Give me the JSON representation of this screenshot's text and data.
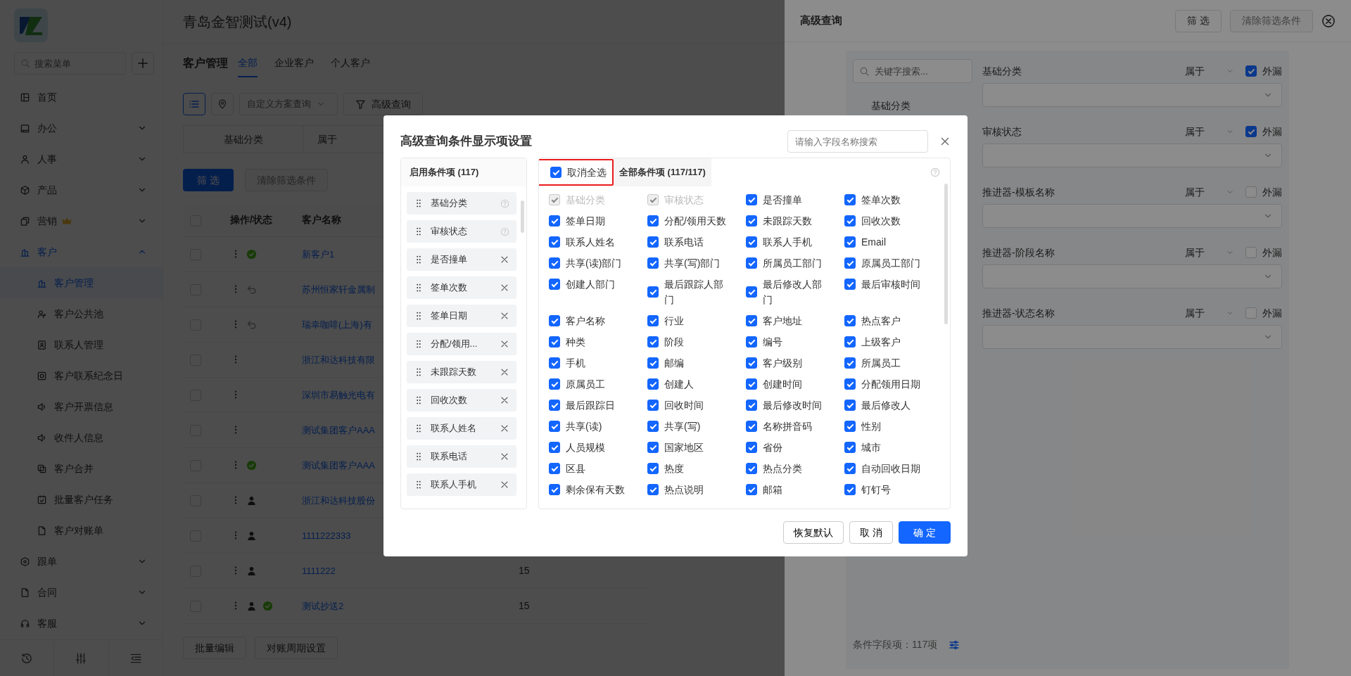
{
  "app": {
    "title": "青岛金智测试(v4)"
  },
  "sidebar": {
    "search": {
      "placeholder": "搜索菜单"
    },
    "items": [
      {
        "label": "首页",
        "kind": "link",
        "selected": false,
        "premium": false
      },
      {
        "label": "办公",
        "kind": "group",
        "expanded": false,
        "selected": false,
        "premium": false
      },
      {
        "label": "人事",
        "kind": "group",
        "expanded": false,
        "selected": false,
        "premium": false
      },
      {
        "label": "产品",
        "kind": "group",
        "expanded": false,
        "selected": false,
        "premium": false
      },
      {
        "label": "营销",
        "kind": "group",
        "expanded": false,
        "selected": false,
        "premium": true
      },
      {
        "label": "客户",
        "kind": "group",
        "expanded": true,
        "selected": true,
        "premium": false,
        "children": [
          {
            "label": "客户管理",
            "selected": true
          },
          {
            "label": "客户公共池",
            "selected": false
          },
          {
            "label": "联系人管理",
            "selected": false
          },
          {
            "label": "客户联系纪念日",
            "selected": false
          },
          {
            "label": "客户开票信息",
            "selected": false
          },
          {
            "label": "收件人信息",
            "selected": false
          },
          {
            "label": "客户合并",
            "selected": false
          },
          {
            "label": "批量客户任务",
            "selected": false
          },
          {
            "label": "客户对账单",
            "selected": false
          }
        ]
      },
      {
        "label": "跟单",
        "kind": "group",
        "expanded": false,
        "selected": false,
        "premium": false
      },
      {
        "label": "合同",
        "kind": "group",
        "expanded": false,
        "selected": false,
        "premium": false
      },
      {
        "label": "客服",
        "kind": "group",
        "expanded": false,
        "selected": false,
        "premium": false
      }
    ]
  },
  "main": {
    "title": "客户管理",
    "tabs": [
      {
        "label": "全部",
        "selected": true
      },
      {
        "label": "企业客户",
        "selected": false
      },
      {
        "label": "个人客户",
        "selected": false
      }
    ],
    "view_modes": [
      {
        "kind": "list",
        "selected": true
      },
      {
        "kind": "map",
        "selected": false
      }
    ],
    "scheme_select": {
      "placeholder": "自定义方案查询"
    },
    "advanced_button": "高级查询",
    "filter": {
      "field": "基础分类",
      "operator": "属于"
    },
    "filter_button": "筛 选",
    "clear_button": {
      "label": "清除筛选条件",
      "disabled": true
    },
    "table": {
      "select_all": false,
      "columns": [
        "操作/状态",
        "客户名称"
      ],
      "rows": [
        {
          "selected": false,
          "status": [
            {
              "kind": "approved"
            }
          ],
          "name": "新客户1"
        },
        {
          "selected": false,
          "status": [
            {
              "kind": "returned"
            }
          ],
          "name": "苏州恒家轩金属制"
        },
        {
          "selected": false,
          "status": [
            {
              "kind": "returned"
            }
          ],
          "name": "瑞幸咖啡(上海)有"
        },
        {
          "selected": false,
          "status": [],
          "name": "浙江和达科技有限"
        },
        {
          "selected": false,
          "status": [],
          "name": "深圳市易触光电有"
        },
        {
          "selected": false,
          "status": [],
          "name": "测试集团客户AAA"
        },
        {
          "selected": false,
          "status": [
            {
              "kind": "approved"
            }
          ],
          "name": "测试集团客户AAA"
        },
        {
          "selected": false,
          "status": [
            {
              "kind": "personal"
            }
          ],
          "name": "浙江和达科技股份"
        },
        {
          "selected": false,
          "status": [
            {
              "kind": "personal"
            }
          ],
          "name": "1111222333"
        },
        {
          "selected": false,
          "status": [
            {
              "kind": "personal"
            }
          ],
          "name": "1111222",
          "column_4": "15"
        },
        {
          "selected": false,
          "status": [
            {
              "kind": "personal"
            },
            {
              "kind": "approved"
            }
          ],
          "name": "测试抄送2",
          "column_4": "15"
        }
      ]
    },
    "footer_buttons": [
      "批量编辑",
      "对账周期设置"
    ]
  },
  "drawer": {
    "title": "高级查询",
    "filter_button": "筛 选",
    "clear_button": {
      "label": "清除筛选条件",
      "disabled": true
    },
    "search": {
      "placeholder": "关键字搜索..."
    },
    "field_list": [
      "基础分类"
    ],
    "conditions": [
      {
        "label": "基础分类",
        "operator": "属于",
        "outer_label": "外漏",
        "outer": true
      },
      {
        "label": "审核状态",
        "operator": "属于",
        "outer_label": "外漏",
        "outer": true
      },
      {
        "label": "推进器-模板名称",
        "operator": "属于",
        "outer_label": "外漏",
        "outer": false
      },
      {
        "label": "推进器-阶段名称",
        "operator": "属于",
        "outer_label": "外漏",
        "outer": false
      },
      {
        "label": "推进器-状态名称",
        "operator": "属于",
        "outer_label": "外漏",
        "outer": false
      }
    ],
    "footer": "条件字段项：117项"
  },
  "modal": {
    "title": "高级查询条件显示项设置",
    "search": {
      "placeholder": "请输入字段名称搜索"
    },
    "enabled": {
      "title": "启用条件项 (117)",
      "items": [
        {
          "label": "基础分类",
          "kind": "locked"
        },
        {
          "label": "审核状态",
          "kind": "locked"
        },
        {
          "label": "是否撞单",
          "kind": "removable"
        },
        {
          "label": "签单次数",
          "kind": "removable"
        },
        {
          "label": "签单日期",
          "kind": "removable"
        },
        {
          "label": "分配/领用...",
          "kind": "removable"
        },
        {
          "label": "未跟踪天数",
          "kind": "removable"
        },
        {
          "label": "回收次数",
          "kind": "removable"
        },
        {
          "label": "联系人姓名",
          "kind": "removable"
        },
        {
          "label": "联系电话",
          "kind": "removable"
        },
        {
          "label": "联系人手机",
          "kind": "removable"
        }
      ]
    },
    "all": {
      "toggle": {
        "label": "取消全选",
        "checked": true,
        "highlighted": true
      },
      "title": "全部条件项 (117/117)",
      "items": [
        {
          "label": "基础分类",
          "checked": true,
          "disabled": true
        },
        {
          "label": "审核状态",
          "checked": true,
          "disabled": true
        },
        {
          "label": "是否撞单",
          "checked": true,
          "disabled": false
        },
        {
          "label": "签单次数",
          "checked": true,
          "disabled": false
        },
        {
          "label": "签单日期",
          "checked": true,
          "disabled": false
        },
        {
          "label": "分配/领用天数",
          "checked": true,
          "disabled": false
        },
        {
          "label": "未跟踪天数",
          "checked": true,
          "disabled": false
        },
        {
          "label": "回收次数",
          "checked": true,
          "disabled": false
        },
        {
          "label": "联系人姓名",
          "checked": true,
          "disabled": false
        },
        {
          "label": "联系电话",
          "checked": true,
          "disabled": false
        },
        {
          "label": "联系人手机",
          "checked": true,
          "disabled": false
        },
        {
          "label": "Email",
          "checked": true,
          "disabled": false
        },
        {
          "label": "共享(读)部门",
          "checked": true,
          "disabled": false
        },
        {
          "label": "共享(写)部门",
          "checked": true,
          "disabled": false
        },
        {
          "label": "所属员工部门",
          "checked": true,
          "disabled": false
        },
        {
          "label": "原属员工部门",
          "checked": true,
          "disabled": false
        },
        {
          "label": "创建人部门",
          "checked": true,
          "disabled": false
        },
        {
          "label": "最后跟踪人部门",
          "checked": true,
          "disabled": false
        },
        {
          "label": "最后修改人部门",
          "checked": true,
          "disabled": false
        },
        {
          "label": "最后审核时间",
          "checked": true,
          "disabled": false
        },
        {
          "label": "客户名称",
          "checked": true,
          "disabled": false
        },
        {
          "label": "行业",
          "checked": true,
          "disabled": false
        },
        {
          "label": "客户地址",
          "checked": true,
          "disabled": false
        },
        {
          "label": "热点客户",
          "checked": true,
          "disabled": false
        },
        {
          "label": "种类",
          "checked": true,
          "disabled": false
        },
        {
          "label": "阶段",
          "checked": true,
          "disabled": false
        },
        {
          "label": "编号",
          "checked": true,
          "disabled": false
        },
        {
          "label": "上级客户",
          "checked": true,
          "disabled": false
        },
        {
          "label": "手机",
          "checked": true,
          "disabled": false
        },
        {
          "label": "邮编",
          "checked": true,
          "disabled": false
        },
        {
          "label": "客户级别",
          "checked": true,
          "disabled": false
        },
        {
          "label": "所属员工",
          "checked": true,
          "disabled": false
        },
        {
          "label": "原属员工",
          "checked": true,
          "disabled": false
        },
        {
          "label": "创建人",
          "checked": true,
          "disabled": false
        },
        {
          "label": "创建时间",
          "checked": true,
          "disabled": false
        },
        {
          "label": "分配领用日期",
          "checked": true,
          "disabled": false
        },
        {
          "label": "最后跟踪日",
          "checked": true,
          "disabled": false
        },
        {
          "label": "回收时间",
          "checked": true,
          "disabled": false
        },
        {
          "label": "最后修改时间",
          "checked": true,
          "disabled": false
        },
        {
          "label": "最后修改人",
          "checked": true,
          "disabled": false
        },
        {
          "label": "共享(读)",
          "checked": true,
          "disabled": false
        },
        {
          "label": "共享(写)",
          "checked": true,
          "disabled": false
        },
        {
          "label": "名称拼音码",
          "checked": true,
          "disabled": false
        },
        {
          "label": "性别",
          "checked": true,
          "disabled": false
        },
        {
          "label": "人员规模",
          "checked": true,
          "disabled": false
        },
        {
          "label": "国家地区",
          "checked": true,
          "disabled": false
        },
        {
          "label": "省份",
          "checked": true,
          "disabled": false
        },
        {
          "label": "城市",
          "checked": true,
          "disabled": false
        },
        {
          "label": "区县",
          "checked": true,
          "disabled": false
        },
        {
          "label": "热度",
          "checked": true,
          "disabled": false
        },
        {
          "label": "热点分类",
          "checked": true,
          "disabled": false
        },
        {
          "label": "自动回收日期",
          "checked": true,
          "disabled": false
        },
        {
          "label": "剩余保有天数",
          "checked": true,
          "disabled": false
        },
        {
          "label": "热点说明",
          "checked": true,
          "disabled": false
        },
        {
          "label": "邮箱",
          "checked": true,
          "disabled": false
        },
        {
          "label": "钉钉号",
          "checked": true,
          "disabled": false
        }
      ]
    },
    "buttons": [
      {
        "label": "恢复默认",
        "kind": "default"
      },
      {
        "label": "取 消",
        "kind": "default"
      },
      {
        "label": "确 定",
        "kind": "primary"
      }
    ]
  }
}
